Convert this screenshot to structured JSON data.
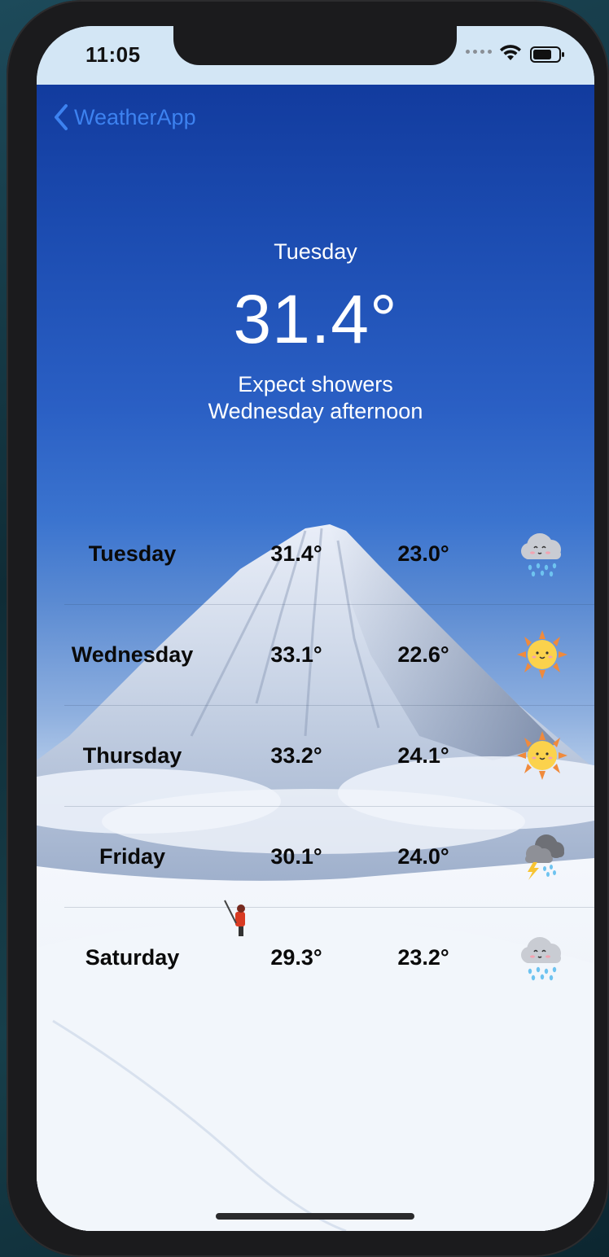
{
  "status_bar": {
    "time": "11:05"
  },
  "nav": {
    "back_label": "WeatherApp"
  },
  "hero": {
    "day": "Tuesday",
    "temperature": "31.4°",
    "description_line1": "Expect showers",
    "description_line2": "Wednesday afternoon"
  },
  "forecast": [
    {
      "day": "Tuesday",
      "high": "31.4°",
      "low": "23.0°",
      "icon": "rain-cloud-icon"
    },
    {
      "day": "Wednesday",
      "high": "33.1°",
      "low": "22.6°",
      "icon": "sun-icon"
    },
    {
      "day": "Thursday",
      "high": "33.2°",
      "low": "24.1°",
      "icon": "sun-icon"
    },
    {
      "day": "Friday",
      "high": "30.1°",
      "low": "24.0°",
      "icon": "thunderstorm-icon"
    },
    {
      "day": "Saturday",
      "high": "29.3°",
      "low": "23.2°",
      "icon": "rain-cloud-icon"
    }
  ],
  "colors": {
    "accent": "#3d82f0",
    "sky_top": "#123b9e",
    "text_dark": "#0a0a0a"
  }
}
